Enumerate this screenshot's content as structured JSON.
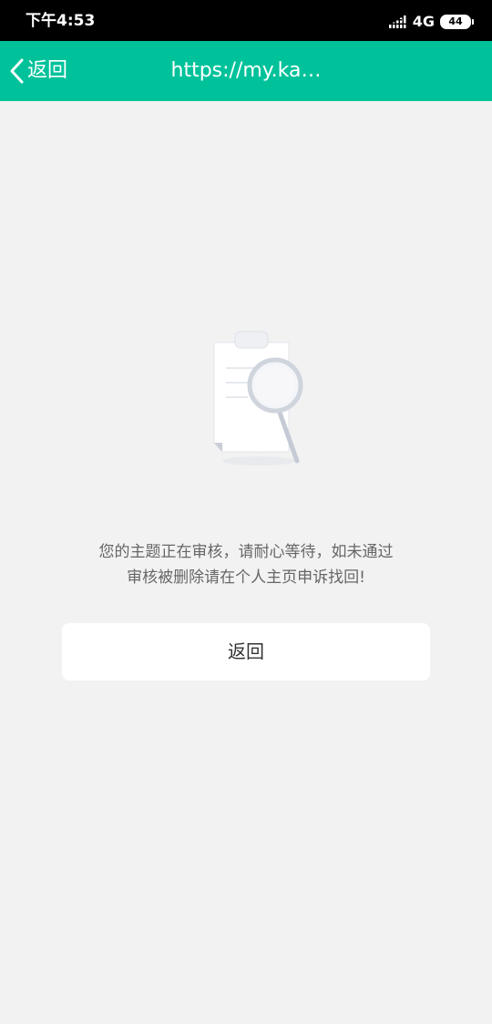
{
  "status_bar": {
    "time": "下午4:53",
    "network": "4G",
    "battery": "44",
    "icons": [
      "signal-icon",
      "battery-icon"
    ]
  },
  "nav_bar": {
    "back_label": "返回",
    "title": "https://my.ka…",
    "background_color": "#00c29a",
    "icons": [
      "chevron-left-icon"
    ]
  },
  "content": {
    "illustration": "clipboard-magnifier-icon",
    "message_line1": "您的主题正在审核，请耐心等待，如未通过",
    "message_line2": "审核被删除请在个人主页申诉找回!",
    "button_label": "返回"
  }
}
